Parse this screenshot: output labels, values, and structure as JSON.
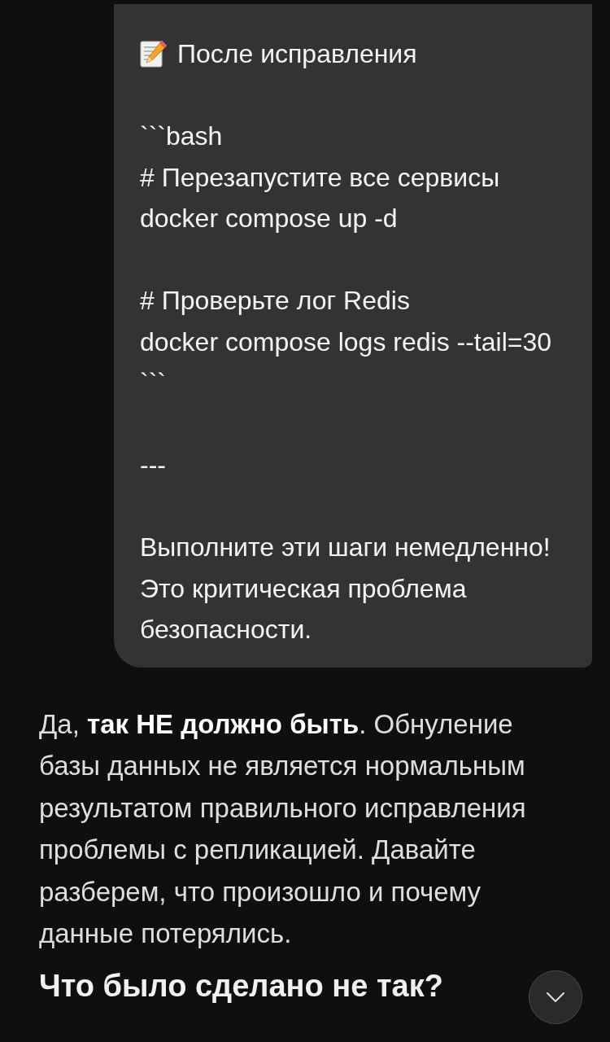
{
  "user_message": {
    "heading": "После исправления",
    "paragraphs": [
      [
        "```bash",
        "# Перезапустите все сервисы",
        "docker compose up -d"
      ],
      [
        "# Проверьте лог Redis",
        "docker compose logs redis --tail=30",
        "```"
      ],
      [
        "---"
      ],
      [
        "Выполните эти шаги немедленно! Это критическая проблема безопасности."
      ]
    ]
  },
  "assistant_reply": {
    "paragraph": "Да, **так НЕ должно быть**. Обнуление базы данных не является нормальным результатом правильного исправления проблемы с репликацией. Давайте разберем, что произошло и почему данные потерялись.",
    "heading": "Что было сделано не так?"
  }
}
